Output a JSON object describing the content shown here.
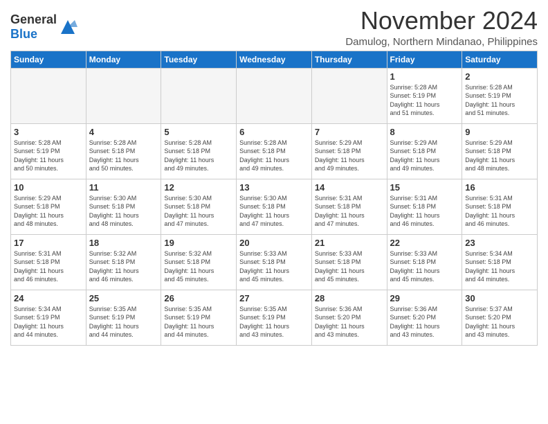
{
  "header": {
    "logo_general": "General",
    "logo_blue": "Blue",
    "month_title": "November 2024",
    "location": "Damulog, Northern Mindanao, Philippines"
  },
  "days_of_week": [
    "Sunday",
    "Monday",
    "Tuesday",
    "Wednesday",
    "Thursday",
    "Friday",
    "Saturday"
  ],
  "weeks": [
    [
      {
        "day": "",
        "info": ""
      },
      {
        "day": "",
        "info": ""
      },
      {
        "day": "",
        "info": ""
      },
      {
        "day": "",
        "info": ""
      },
      {
        "day": "",
        "info": ""
      },
      {
        "day": "1",
        "info": "Sunrise: 5:28 AM\nSunset: 5:19 PM\nDaylight: 11 hours\nand 51 minutes."
      },
      {
        "day": "2",
        "info": "Sunrise: 5:28 AM\nSunset: 5:19 PM\nDaylight: 11 hours\nand 51 minutes."
      }
    ],
    [
      {
        "day": "3",
        "info": "Sunrise: 5:28 AM\nSunset: 5:19 PM\nDaylight: 11 hours\nand 50 minutes."
      },
      {
        "day": "4",
        "info": "Sunrise: 5:28 AM\nSunset: 5:18 PM\nDaylight: 11 hours\nand 50 minutes."
      },
      {
        "day": "5",
        "info": "Sunrise: 5:28 AM\nSunset: 5:18 PM\nDaylight: 11 hours\nand 49 minutes."
      },
      {
        "day": "6",
        "info": "Sunrise: 5:28 AM\nSunset: 5:18 PM\nDaylight: 11 hours\nand 49 minutes."
      },
      {
        "day": "7",
        "info": "Sunrise: 5:29 AM\nSunset: 5:18 PM\nDaylight: 11 hours\nand 49 minutes."
      },
      {
        "day": "8",
        "info": "Sunrise: 5:29 AM\nSunset: 5:18 PM\nDaylight: 11 hours\nand 49 minutes."
      },
      {
        "day": "9",
        "info": "Sunrise: 5:29 AM\nSunset: 5:18 PM\nDaylight: 11 hours\nand 48 minutes."
      }
    ],
    [
      {
        "day": "10",
        "info": "Sunrise: 5:29 AM\nSunset: 5:18 PM\nDaylight: 11 hours\nand 48 minutes."
      },
      {
        "day": "11",
        "info": "Sunrise: 5:30 AM\nSunset: 5:18 PM\nDaylight: 11 hours\nand 48 minutes."
      },
      {
        "day": "12",
        "info": "Sunrise: 5:30 AM\nSunset: 5:18 PM\nDaylight: 11 hours\nand 47 minutes."
      },
      {
        "day": "13",
        "info": "Sunrise: 5:30 AM\nSunset: 5:18 PM\nDaylight: 11 hours\nand 47 minutes."
      },
      {
        "day": "14",
        "info": "Sunrise: 5:31 AM\nSunset: 5:18 PM\nDaylight: 11 hours\nand 47 minutes."
      },
      {
        "day": "15",
        "info": "Sunrise: 5:31 AM\nSunset: 5:18 PM\nDaylight: 11 hours\nand 46 minutes."
      },
      {
        "day": "16",
        "info": "Sunrise: 5:31 AM\nSunset: 5:18 PM\nDaylight: 11 hours\nand 46 minutes."
      }
    ],
    [
      {
        "day": "17",
        "info": "Sunrise: 5:31 AM\nSunset: 5:18 PM\nDaylight: 11 hours\nand 46 minutes."
      },
      {
        "day": "18",
        "info": "Sunrise: 5:32 AM\nSunset: 5:18 PM\nDaylight: 11 hours\nand 46 minutes."
      },
      {
        "day": "19",
        "info": "Sunrise: 5:32 AM\nSunset: 5:18 PM\nDaylight: 11 hours\nand 45 minutes."
      },
      {
        "day": "20",
        "info": "Sunrise: 5:33 AM\nSunset: 5:18 PM\nDaylight: 11 hours\nand 45 minutes."
      },
      {
        "day": "21",
        "info": "Sunrise: 5:33 AM\nSunset: 5:18 PM\nDaylight: 11 hours\nand 45 minutes."
      },
      {
        "day": "22",
        "info": "Sunrise: 5:33 AM\nSunset: 5:18 PM\nDaylight: 11 hours\nand 45 minutes."
      },
      {
        "day": "23",
        "info": "Sunrise: 5:34 AM\nSunset: 5:18 PM\nDaylight: 11 hours\nand 44 minutes."
      }
    ],
    [
      {
        "day": "24",
        "info": "Sunrise: 5:34 AM\nSunset: 5:19 PM\nDaylight: 11 hours\nand 44 minutes."
      },
      {
        "day": "25",
        "info": "Sunrise: 5:35 AM\nSunset: 5:19 PM\nDaylight: 11 hours\nand 44 minutes."
      },
      {
        "day": "26",
        "info": "Sunrise: 5:35 AM\nSunset: 5:19 PM\nDaylight: 11 hours\nand 44 minutes."
      },
      {
        "day": "27",
        "info": "Sunrise: 5:35 AM\nSunset: 5:19 PM\nDaylight: 11 hours\nand 43 minutes."
      },
      {
        "day": "28",
        "info": "Sunrise: 5:36 AM\nSunset: 5:20 PM\nDaylight: 11 hours\nand 43 minutes."
      },
      {
        "day": "29",
        "info": "Sunrise: 5:36 AM\nSunset: 5:20 PM\nDaylight: 11 hours\nand 43 minutes."
      },
      {
        "day": "30",
        "info": "Sunrise: 5:37 AM\nSunset: 5:20 PM\nDaylight: 11 hours\nand 43 minutes."
      }
    ]
  ]
}
